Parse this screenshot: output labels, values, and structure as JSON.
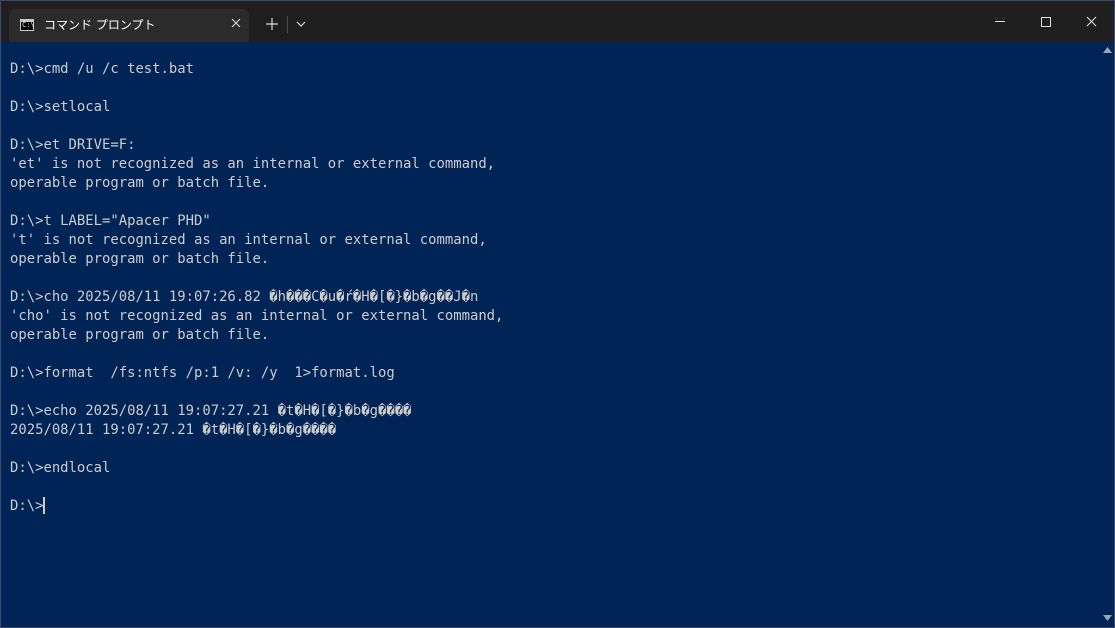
{
  "titlebar": {
    "tab_title": "コマンド プロンプト",
    "tab_icon": "cmd-icon",
    "tab_icon_glyph": "C:\\",
    "new_tab_icon": "plus-icon",
    "dropdown_icon": "chevron-down-icon",
    "close_tab_icon": "close-icon",
    "window_buttons": [
      "minimize-icon",
      "maximize-icon",
      "close-icon"
    ]
  },
  "terminal": {
    "background": "#012456",
    "foreground": "#cccccc",
    "lines": [
      "D:\\>cmd /u /c test.bat",
      "",
      "D:\\>setlocal",
      "",
      "D:\\>et DRIVE=F:",
      "'et' is not recognized as an internal or external command,",
      "operable program or batch file.",
      "",
      "D:\\>t LABEL=\"Apacer PHD\"",
      "'t' is not recognized as an internal or external command,",
      "operable program or batch file.",
      "",
      "D:\\>cho 2025/08/11 19:07:26.82 �h���C�u�ŕ�H�[�}�b�g��J�n",
      "'cho' is not recognized as an internal or external command,",
      "operable program or batch file.",
      "",
      "D:\\>format  /fs:ntfs /p:1 /v: /y  1>format.log",
      "",
      "D:\\>echo 2025/08/11 19:07:27.21 �t�H�[�}�b�g����",
      "2025/08/11 19:07:27.21 �t�H�[�}�b�g����",
      "",
      "D:\\>endlocal",
      ""
    ],
    "prompt": "D:\\>"
  }
}
